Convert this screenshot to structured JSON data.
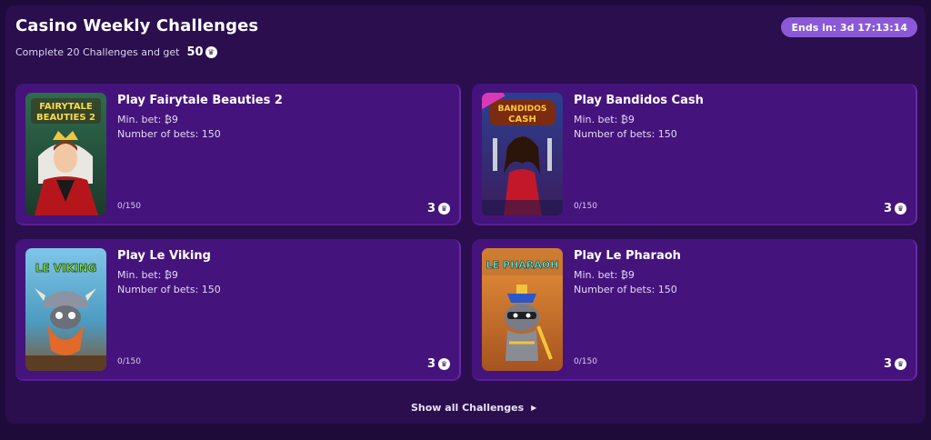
{
  "header": {
    "title": "Casino Weekly Challenges",
    "subtitle": "Complete 20 Challenges and get",
    "reward_total": "50",
    "timer": "Ends in: 3d 17:13:14"
  },
  "challenges": [
    {
      "title": "Play Fairytale Beauties 2",
      "min_bet": "Min. bet: ₿9",
      "num_bets": "Number of bets: 150",
      "progress": "0/150",
      "points": "3",
      "logo_text": "FAIRYTALE BEAUTIES 2"
    },
    {
      "title": "Play Bandidos Cash",
      "min_bet": "Min. bet: ₿9",
      "num_bets": "Number of bets: 150",
      "progress": "0/150",
      "points": "3",
      "logo_text": "BANDIDOS CASH"
    },
    {
      "title": "Play Le Viking",
      "min_bet": "Min. bet: ₿9",
      "num_bets": "Number of bets: 150",
      "progress": "0/150",
      "points": "3",
      "logo_text": "LE VIKING"
    },
    {
      "title": "Play Le Pharaoh",
      "min_bet": "Min. bet: ₿9",
      "num_bets": "Number of bets: 150",
      "progress": "0/150",
      "points": "3",
      "logo_text": "LE PHARAOH"
    }
  ],
  "footer": {
    "show_all": "Show all Challenges"
  },
  "icons": {
    "crown": "crown-icon",
    "chevron": "caret-right-icon"
  },
  "colors": {
    "panel": "#2a0e4e",
    "card": "#45137c",
    "timer_pill": "#8b59d6"
  }
}
